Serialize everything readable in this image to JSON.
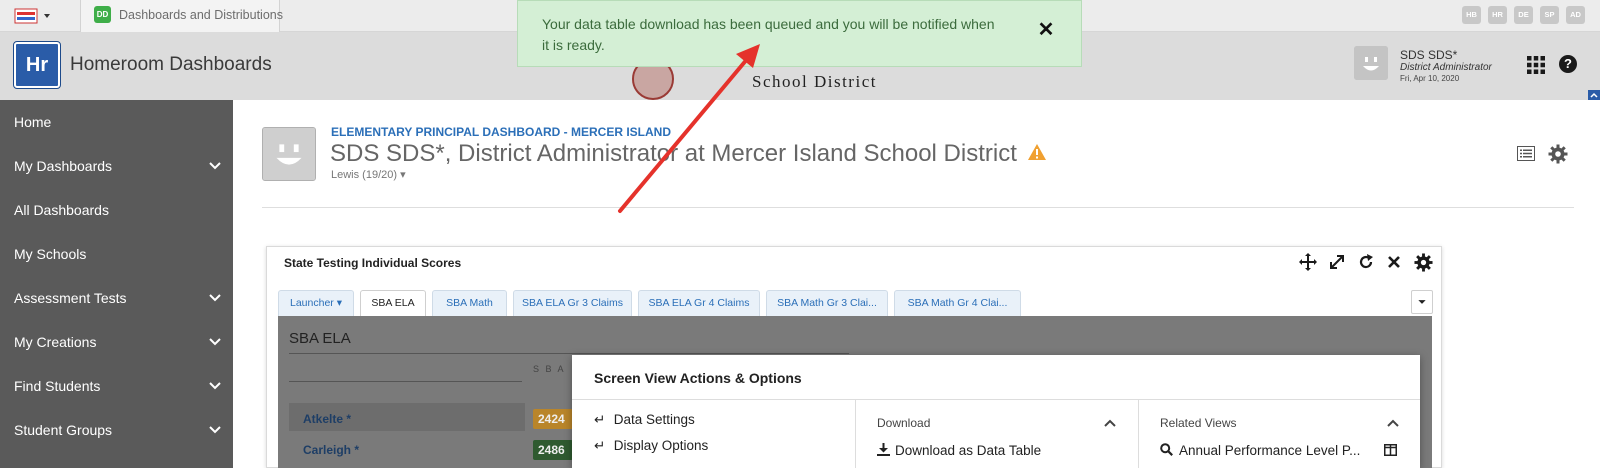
{
  "browser": {
    "tab_title": "Dashboards and Distributions",
    "tab_badge": "DD",
    "extensions": [
      "HB",
      "HR",
      "DE",
      "SP",
      "AD"
    ]
  },
  "header": {
    "logo_text": "Hr",
    "app_title": "Homeroom Dashboards",
    "district_name": "School District",
    "user": {
      "name": "SDS SDS*",
      "role": "District Administrator",
      "date": "Fri, Apr 10, 2020"
    }
  },
  "toast": {
    "message": "Your data table download has been queued and you will be notified when it is ready.",
    "close_glyph": "✕"
  },
  "sidebar": {
    "items": [
      {
        "label": "Home",
        "has_children": false
      },
      {
        "label": "My Dashboards",
        "has_children": true
      },
      {
        "label": "All Dashboards",
        "has_children": false
      },
      {
        "label": "My Schools",
        "has_children": false
      },
      {
        "label": "Assessment Tests",
        "has_children": true
      },
      {
        "label": "My Creations",
        "has_children": true
      },
      {
        "label": "Find Students",
        "has_children": true
      },
      {
        "label": "Student Groups",
        "has_children": true
      }
    ]
  },
  "page": {
    "kicker": "ELEMENTARY PRINCIPAL DASHBOARD - MERCER ISLAND",
    "title": "SDS SDS*, District Administrator at Mercer Island School District",
    "subtitle": "Lewis (19/20) ▾"
  },
  "widget": {
    "title": "State Testing Individual Scores",
    "tabs": [
      {
        "label": "Launcher ▾",
        "active": false
      },
      {
        "label": "SBA ELA",
        "active": true
      },
      {
        "label": "SBA Math",
        "active": false
      },
      {
        "label": "SBA ELA Gr 3 Claims",
        "active": false
      },
      {
        "label": "SBA ELA Gr 4 Claims",
        "active": false
      },
      {
        "label": "SBA Math Gr 3 Clai...",
        "active": false
      },
      {
        "label": "SBA Math Gr 4 Clai...",
        "active": false
      }
    ],
    "report": {
      "title": "SBA ELA",
      "column_header": "S B A",
      "rows": [
        {
          "student": "Atkelte *",
          "score": "2424",
          "color": "#b9852a"
        },
        {
          "student": "Carleigh *",
          "score": "2486",
          "color": "#2f5a30"
        }
      ]
    }
  },
  "modal": {
    "title": "Screen View Actions & Options",
    "actions": [
      {
        "label": "Data Settings",
        "icon": "↵"
      },
      {
        "label": "Display Options",
        "icon": "↵"
      }
    ],
    "download": {
      "heading": "Download",
      "items": [
        "Download as Data Table"
      ]
    },
    "related": {
      "heading": "Related Views",
      "items": [
        "Annual Performance Level P..."
      ]
    }
  },
  "colors": {
    "sidebar_bg": "#5a5a5a",
    "toast_bg": "#d4efd5",
    "toast_text": "#3b6b3c",
    "link_blue": "#2b6fb8",
    "brand_blue": "#2a5ca8",
    "annotation_red": "#e5322b"
  }
}
